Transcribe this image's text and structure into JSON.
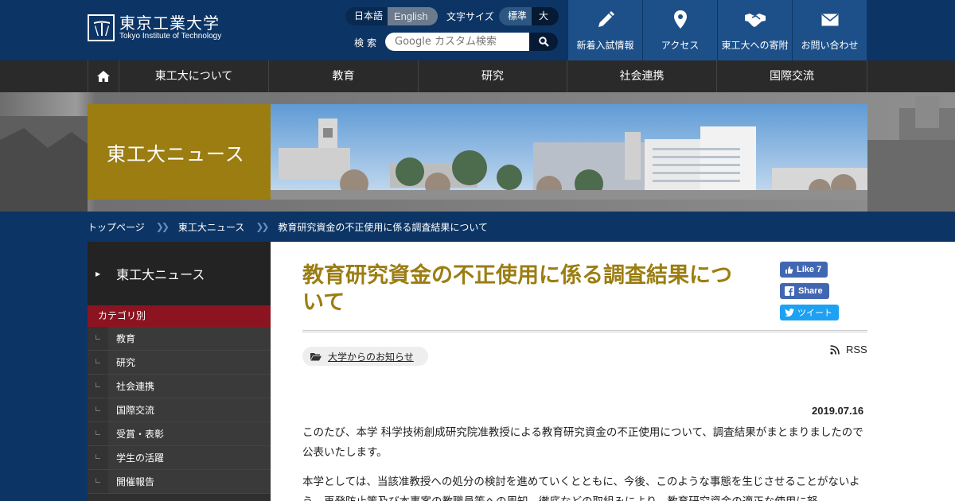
{
  "header": {
    "logo_ja": "東京工業大学",
    "logo_en": "Tokyo Institute of Technology",
    "lang_ja": "日本語",
    "lang_en": "English",
    "font_size_label": "文字サイズ",
    "font_size_standard": "標準",
    "font_size_large": "大",
    "search_label": "検索",
    "search_placeholder": "Google カスタム検索",
    "topnav": [
      {
        "label": "新着入試情報",
        "icon": "pencil-icon"
      },
      {
        "label": "アクセス",
        "icon": "map-pin-icon"
      },
      {
        "label": "東工大への寄附",
        "icon": "handshake-icon"
      },
      {
        "label": "お問い合わせ",
        "icon": "mail-icon"
      }
    ]
  },
  "gnav": {
    "home_icon": "home-icon",
    "items": [
      "東工大について",
      "教育",
      "研究",
      "社会連携",
      "国際交流"
    ]
  },
  "hero": {
    "title": "東工大ニュース"
  },
  "breadcrumb": [
    "トップページ",
    "東工大ニュース",
    "教育研究資金の不正使用に係る調査結果について"
  ],
  "sidebar": {
    "heading": "東工大ニュース",
    "category_label": "カテゴリ別",
    "items": [
      "教育",
      "研究",
      "社会連携",
      "国際交流",
      "受賞・表彰",
      "学生の活躍",
      "開催報告"
    ]
  },
  "article": {
    "title": "教育研究資金の不正使用に係る調査結果について",
    "social": {
      "like": "Like 7",
      "share": "Share",
      "tweet": "ツイート"
    },
    "tag": "大学からのお知らせ",
    "rss": "RSS",
    "date": "2019.07.16",
    "paragraph1": "このたび、本学 科学技術創成研究院准教授による教育研究資金の不正使用について、調査結果がまとまりましたので公表いたします。",
    "paragraph2": "本学としては、当該准教授への処分の検討を進めていくとともに、今後、このような事態を生じさせることがないよう、再発防止策及び本事案の教職員等への周知、徹底などの取組みにより、教育研究資金の適正な使用に努"
  },
  "colors": {
    "navy": "#0c3565",
    "gold": "#9b7d12",
    "crimson": "#8c1420"
  }
}
